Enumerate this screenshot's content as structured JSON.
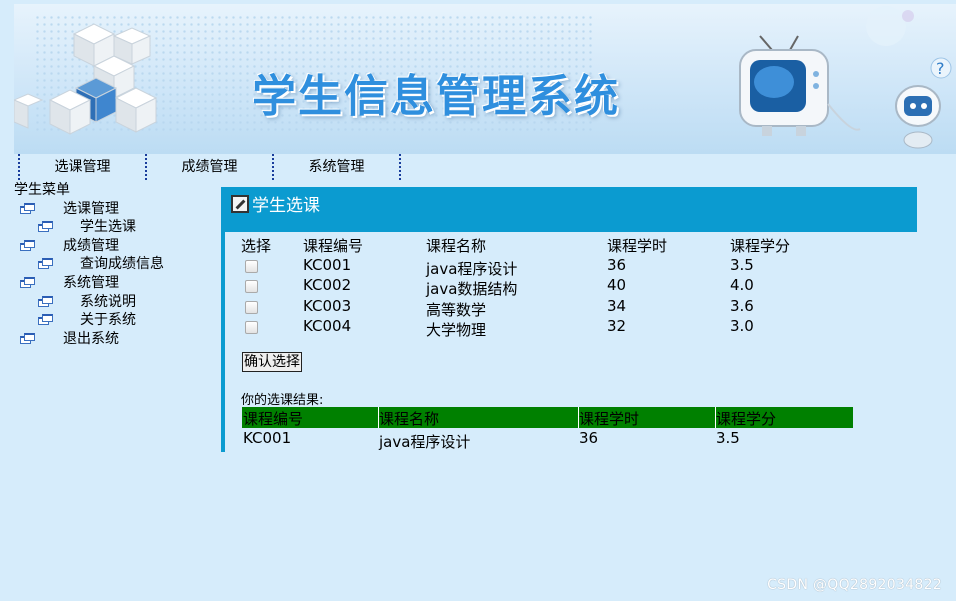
{
  "header": {
    "title": "学生信息管理系统"
  },
  "topmenu": [
    "选课管理",
    "成绩管理",
    "系统管理"
  ],
  "sidebar": {
    "title": "学生菜单",
    "items": [
      {
        "label": "选课管理",
        "level": 1
      },
      {
        "label": "学生选课",
        "level": 2
      },
      {
        "label": "成绩管理",
        "level": 1
      },
      {
        "label": "查询成绩信息",
        "level": 2
      },
      {
        "label": "系统管理",
        "level": 1
      },
      {
        "label": "系统说明",
        "level": 2
      },
      {
        "label": "关于系统",
        "level": 2
      },
      {
        "label": "退出系统",
        "level": 1
      }
    ]
  },
  "panel": {
    "title": "学生选课",
    "columns": [
      "选择",
      "课程编号",
      "课程名称",
      "课程学时",
      "课程学分"
    ],
    "rows": [
      [
        "KC001",
        "java程序设计",
        "36",
        "3.5"
      ],
      [
        "KC002",
        "java数据结构",
        "40",
        "4.0"
      ],
      [
        "KC003",
        "高等数学",
        "34",
        "3.6"
      ],
      [
        "KC004",
        "大学物理",
        "32",
        "3.0"
      ]
    ],
    "confirm_label": "确认选择",
    "result_label": "你的选课结果:",
    "result_columns": [
      "课程编号",
      "课程名称",
      "课程学时",
      "课程学分"
    ],
    "result_rows": [
      [
        "KC001",
        "java程序设计",
        "36",
        "3.5"
      ]
    ],
    "result_header_color": "#008000"
  },
  "watermark": "CSDN @QQ2892034822"
}
